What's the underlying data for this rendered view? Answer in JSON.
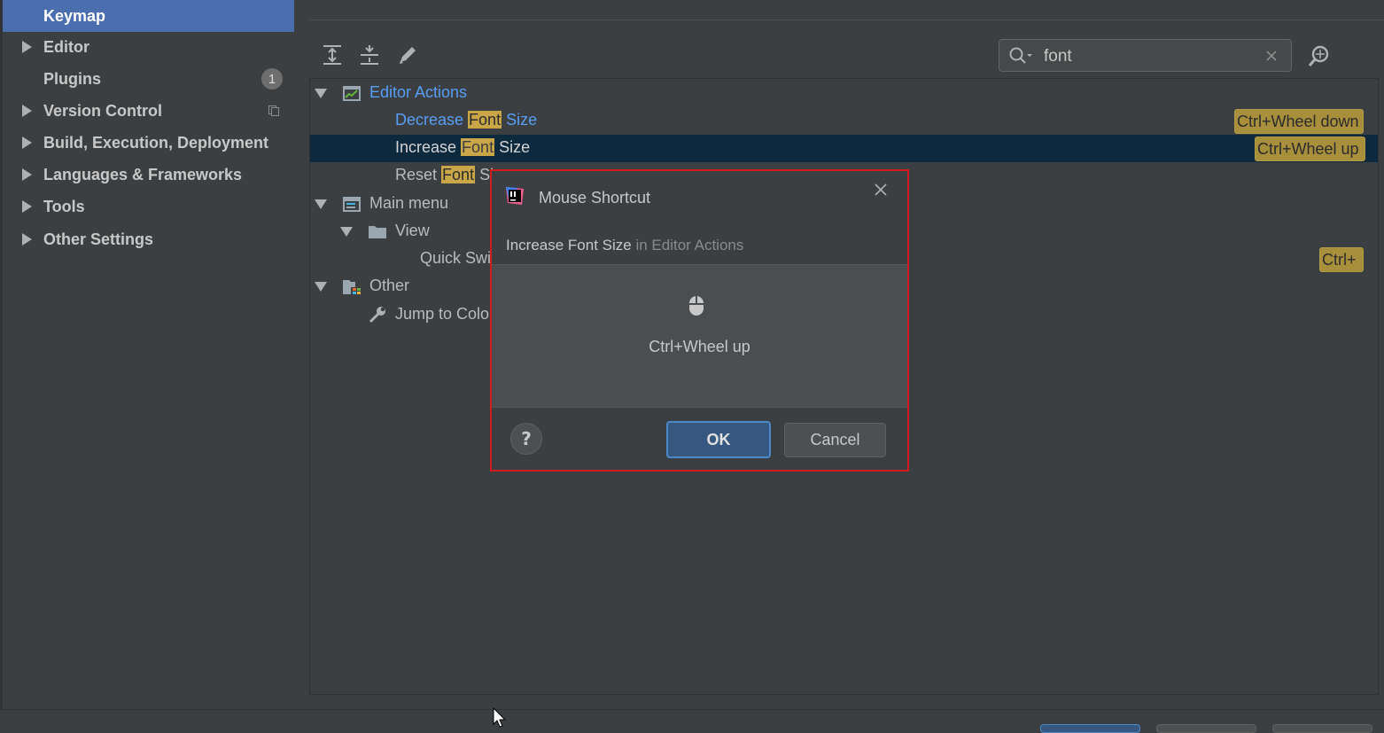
{
  "sidebar": {
    "items": [
      {
        "label": "Keymap",
        "selected": true,
        "arrow": false
      },
      {
        "label": "Editor",
        "arrow": true
      },
      {
        "label": "Plugins",
        "arrow": false,
        "badge": "1"
      },
      {
        "label": "Version Control",
        "arrow": true
      },
      {
        "label": "Build, Execution, Deployment",
        "arrow": true
      },
      {
        "label": "Languages & Frameworks",
        "arrow": true
      },
      {
        "label": "Tools",
        "arrow": true
      },
      {
        "label": "Other Settings",
        "arrow": true
      }
    ]
  },
  "toolbar": {
    "icons": [
      "expand-all-icon",
      "collapse-all-icon",
      "edit-icon"
    ]
  },
  "search": {
    "value": "font",
    "icons": [
      "search-icon",
      "clear-icon",
      "find-shortcut-icon"
    ]
  },
  "tree": {
    "editor_actions": "Editor Actions",
    "decrease": {
      "pre": "Decrease ",
      "match": "Font",
      "post": " Size",
      "shortcut": "Ctrl+Wheel down"
    },
    "increase": {
      "pre": "Increase ",
      "match": "Font",
      "post": " Size",
      "shortcut": "Ctrl+Wheel up"
    },
    "reset": {
      "pre": "Reset ",
      "match": "Font",
      "post": " Si"
    },
    "main_menu": "Main menu",
    "view": "View",
    "quick_switch": "Quick Swi",
    "quick_switch_shortcut": "Ctrl+",
    "other": "Other",
    "jump": "Jump to Colo"
  },
  "dialog": {
    "title": "Mouse Shortcut",
    "action": "Increase Font Size",
    "context": " in Editor Actions",
    "shortcut": "Ctrl+Wheel up",
    "help_label": "?",
    "ok_label": "OK",
    "cancel_label": "Cancel"
  },
  "colors": {
    "highlight": "#c9a647",
    "selection": "#4b6eaf",
    "dialog_border": "#d01c1c",
    "link_blue": "#589df6"
  }
}
